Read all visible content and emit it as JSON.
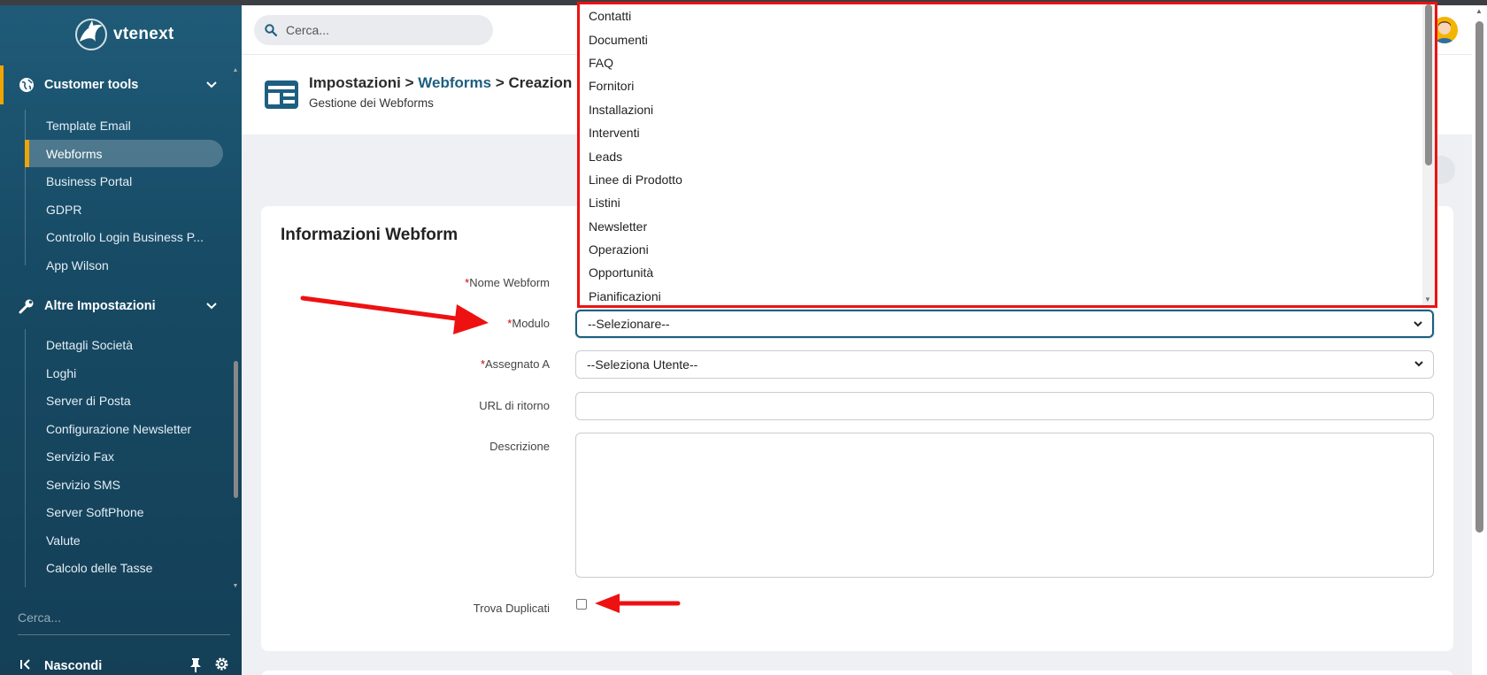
{
  "brand": {
    "name": "vtenext"
  },
  "colors": {
    "sidebar": "#1f5b78",
    "accent": "#f0a500",
    "link": "#1d5f80",
    "required": "#d40000",
    "annotation": "#ee1111"
  },
  "sidebar": {
    "groups": [
      {
        "label": "Customer tools",
        "icon": "globe-icon"
      },
      {
        "label": "Altre Impostazioni",
        "icon": "wrench-icon"
      }
    ],
    "customer_items": [
      "Template Email",
      "Webforms",
      "Business Portal",
      "GDPR",
      "Controllo Login Business P...",
      "App Wilson"
    ],
    "settings_items": [
      "Dettagli Società",
      "Loghi",
      "Server di Posta",
      "Configurazione Newsletter",
      "Servizio Fax",
      "Servizio SMS",
      "Server SoftPhone",
      "Valute",
      "Calcolo delle Tasse"
    ],
    "search_placeholder": "Cerca...",
    "footer_label": "Nascondi"
  },
  "topbar": {
    "search_placeholder": "Cerca..."
  },
  "header": {
    "crumb1": "Impostazioni >",
    "crumb2": "Webforms",
    "crumb3": "> Creazion",
    "subtitle": "Gestione dei Webforms"
  },
  "form": {
    "title": "Informazioni Webform",
    "required_mark": "*",
    "labels": {
      "nome": "Nome Webform",
      "modulo": "Modulo",
      "assegnato": "Assegnato A",
      "url": "URL di ritorno",
      "descrizione": "Descrizione",
      "duplicati": "Trova Duplicati"
    },
    "modulo_value": "--Selezionare--",
    "assegnato_value": "--Seleziona Utente--",
    "url_value": "",
    "descrizione_value": "",
    "trova_duplicati_checked": false
  },
  "dropdown_options": [
    "Contatti",
    "Documenti",
    "FAQ",
    "Fornitori",
    "Installazioni",
    "Interventi",
    "Leads",
    "Linee di Prodotto",
    "Listini",
    "Newsletter",
    "Operazioni",
    "Opportunità",
    "Pianificazioni"
  ]
}
